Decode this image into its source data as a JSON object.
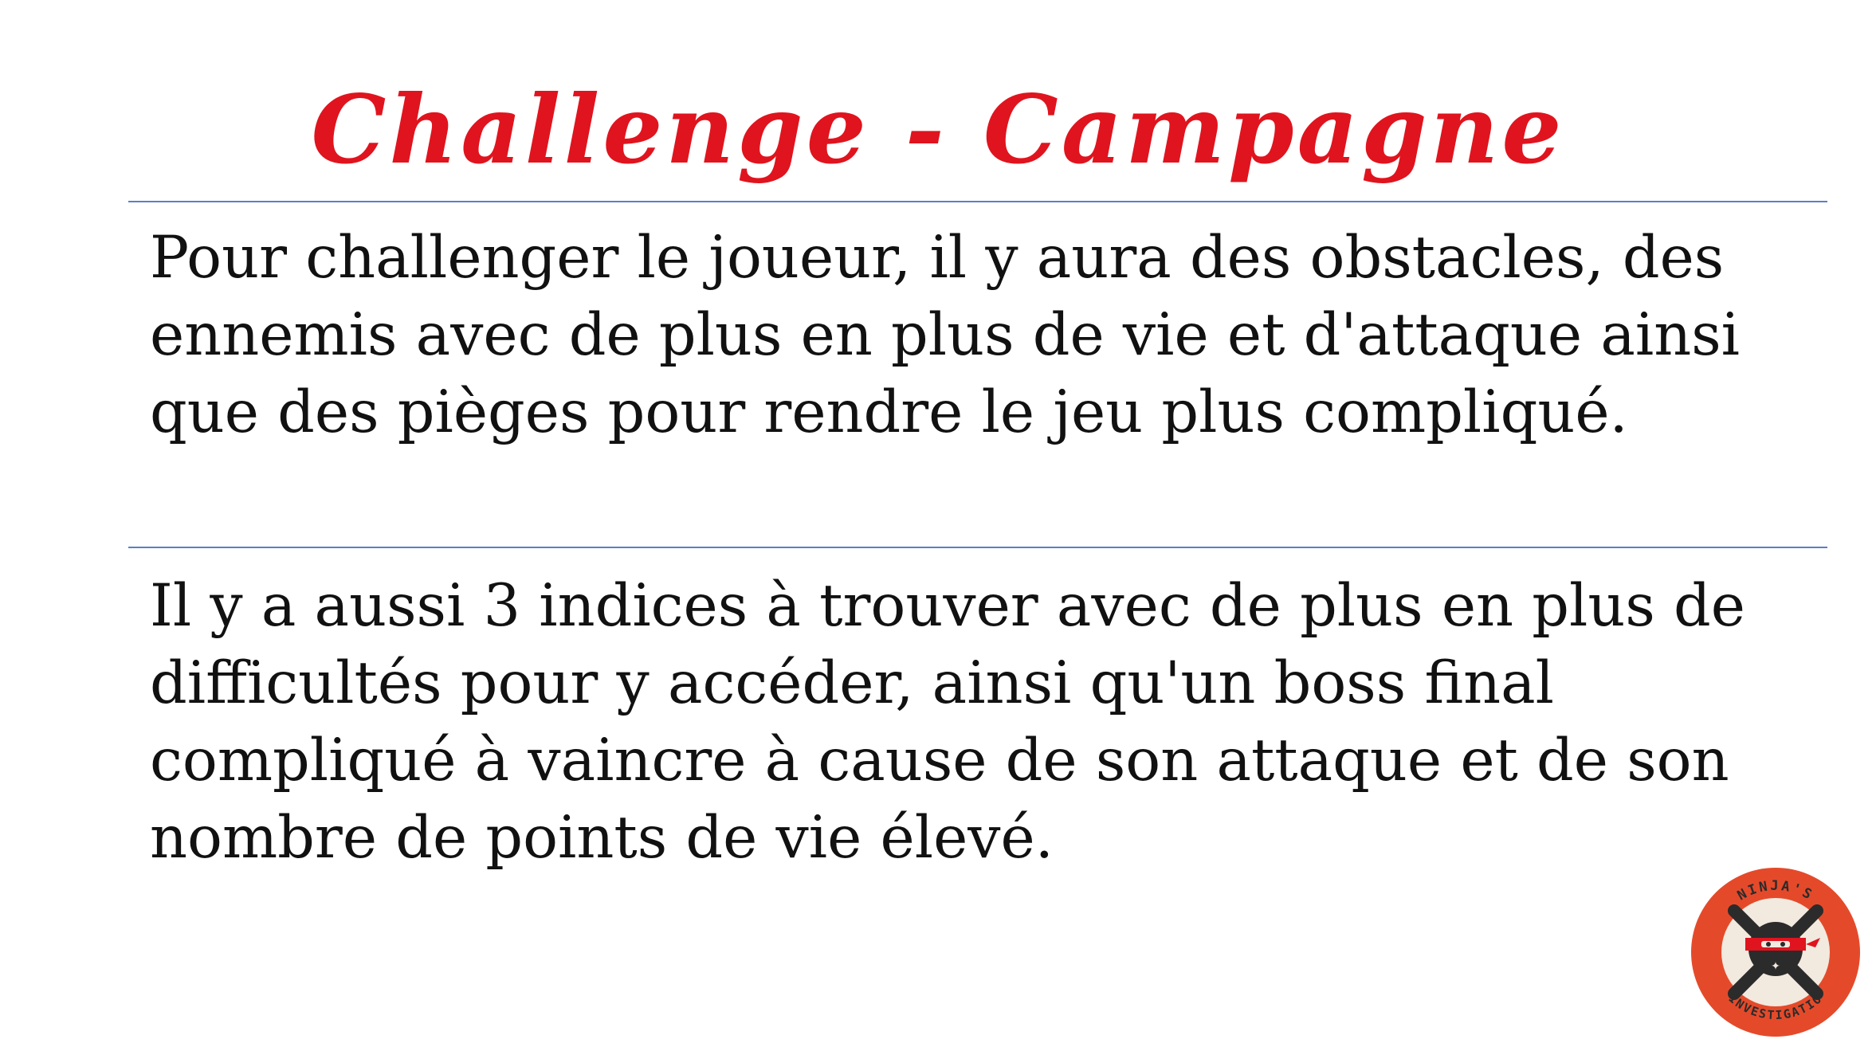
{
  "slide": {
    "title": "Challenge - Campagne",
    "paragraphs": [
      "Pour challenger le joueur, il y aura des obstacles, des ennemis avec de plus en plus de vie et d'attaque ainsi que des pièges pour rendre le jeu plus compliqué.",
      "Il y a aussi 3 indices à trouver avec de plus en plus de difficultés pour y accéder, ainsi qu'un boss final compliqué à vaincre à cause de son attaque et de son nombre de points de vie élevé."
    ]
  },
  "logo": {
    "icon": "ninja-badge-icon",
    "top_text": "NINJA'S",
    "bottom_text": "INVESTIGATIO"
  },
  "colors": {
    "title": "#e0141e",
    "divider": "#5b7ec9",
    "text": "#111111",
    "logo_ring": "#e44a2a",
    "logo_dark": "#2b2b2b"
  }
}
